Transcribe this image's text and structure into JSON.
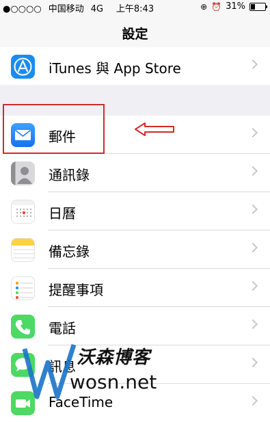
{
  "status_bar": {
    "signal": "●○○○○",
    "carrier": "中国移动",
    "network": "4G",
    "time": "上午8:43",
    "battery": "31%"
  },
  "navbar": {
    "title": "設定"
  },
  "rows": [
    {
      "label": "iTunes 與 App Store",
      "icon": "app-store-icon"
    },
    {
      "label": "郵件",
      "icon": "mail-icon"
    },
    {
      "label": "通訊錄",
      "icon": "contacts-icon"
    },
    {
      "label": "日曆",
      "icon": "calendar-icon"
    },
    {
      "label": "備忘錄",
      "icon": "notes-icon"
    },
    {
      "label": "提醒事項",
      "icon": "reminders-icon"
    },
    {
      "label": "電話",
      "icon": "phone-icon"
    },
    {
      "label": "訊息",
      "icon": "messages-icon"
    },
    {
      "label": "FaceTime",
      "icon": "facetime-icon"
    }
  ],
  "watermark": {
    "title": "沃森博客",
    "url": "wosn.net"
  },
  "colors": {
    "annotation": "#d12a2a",
    "app_store": "#1a8cf0",
    "mail": "#1a7df5",
    "phone": "#4cd964",
    "facetime": "#4cd964"
  }
}
